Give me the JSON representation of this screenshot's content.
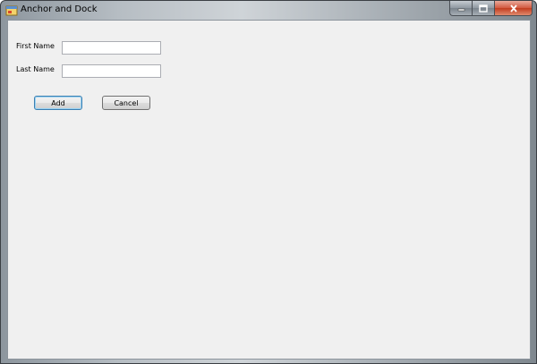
{
  "window": {
    "title": "Anchor and Dock",
    "icon": "app-icon",
    "caption_buttons": {
      "minimize": "minimize-icon",
      "maximize": "maximize-icon",
      "close": "close-icon"
    }
  },
  "form": {
    "first_name_label": "First Name",
    "first_name_value": "",
    "last_name_label": "Last Name",
    "last_name_value": "",
    "add_label": "Add",
    "cancel_label": "Cancel"
  },
  "colors": {
    "client_background": "#f0f0f0",
    "default_button_border": "#3c7fb1",
    "close_button": "#c23c1f"
  }
}
